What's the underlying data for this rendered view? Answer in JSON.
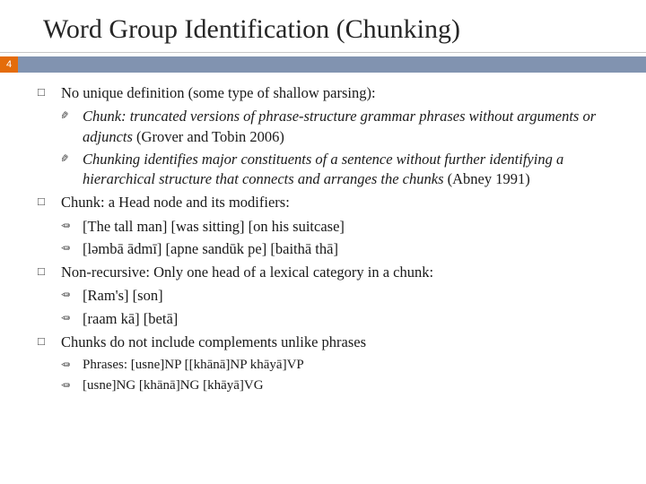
{
  "title": "Word Group Identification (Chunking)",
  "pageNumber": "4",
  "points": {
    "p1": {
      "text": "No unique definition (some type of shallow parsing):",
      "sub1_italic": "Chunk: truncated versions of phrase-structure grammar phrases without arguments or adjuncts ",
      "sub1_roman": "(Grover and Tobin 2006)",
      "sub2_italic": "Chunking identifies major constituents of a sentence without further identifying a hierarchical structure that connects and arranges the chunks ",
      "sub2_roman": "(Abney 1991)"
    },
    "p2": {
      "text": "Chunk: a Head node and its modifiers:",
      "sub1": "[The tall man] [was sitting] [on his suitcase]",
      "sub2": "[ləmbā ādmī] [apne sandūk pe] [baithā thā]"
    },
    "p3": {
      "text": "Non-recursive: Only one head of a lexical category in a chunk:",
      "sub1": "[Ram's] [son]",
      "sub2": "[raam kā] [betā]"
    },
    "p4": {
      "text": "Chunks do not include complements unlike phrases",
      "sub1": "Phrases: [usne]NP [[khānā]NP khāyā]VP",
      "sub2": "[usne]NG [khānā]NG [khāyā]VG"
    }
  }
}
